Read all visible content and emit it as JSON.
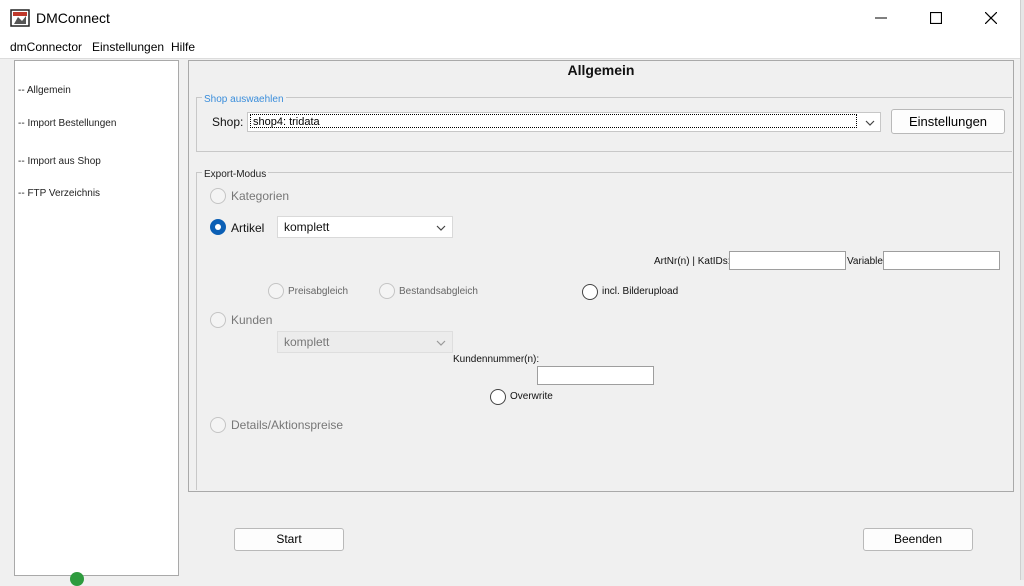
{
  "window": {
    "title": "DMConnect",
    "controls": [
      "minimize",
      "maximize",
      "close"
    ]
  },
  "menu": {
    "items": [
      "dmConnector",
      "Einstellungen",
      "Hilfe"
    ]
  },
  "sidebar": {
    "items": [
      "-- Allgemein",
      "-- Import Bestellungen",
      "-- Import aus Shop",
      "-- FTP Verzeichnis"
    ]
  },
  "main": {
    "title": "Allgemein",
    "shop_group": {
      "label": "Shop auswaehlen",
      "shop_label": "Shop:",
      "shop_value": "shop4: tridata",
      "settings_button": "Einstellungen"
    },
    "export_group": {
      "label": "Export-Modus",
      "kategorien": {
        "label": "Kategorien",
        "selected": false,
        "enabled": false
      },
      "artikel": {
        "label": "Artikel",
        "selected": true,
        "enabled": true,
        "combo_value": "komplett"
      },
      "artnr_label": "ArtNr(n) | KatIDs:",
      "artnr_value": "",
      "variable_label": "Variable:",
      "variable_value": "",
      "preisabgleich": "Preisabgleich",
      "bestandsabgleich": "Bestandsabgleich",
      "bilderupload": "incl. Bilderupload",
      "kunden": {
        "label": "Kunden",
        "selected": false,
        "enabled": false,
        "combo_value": "komplett"
      },
      "kundennummer_label": "Kundennummer(n):",
      "kundennummer_value": "",
      "overwrite": "Overwrite",
      "details": {
        "label": "Details/Aktionspreise",
        "selected": false,
        "enabled": false
      }
    }
  },
  "footer": {
    "start_button": "Start",
    "end_button": "Beenden"
  },
  "colors": {
    "accent": "#0b5fb5",
    "group_label_blue": "#3b8edb"
  }
}
